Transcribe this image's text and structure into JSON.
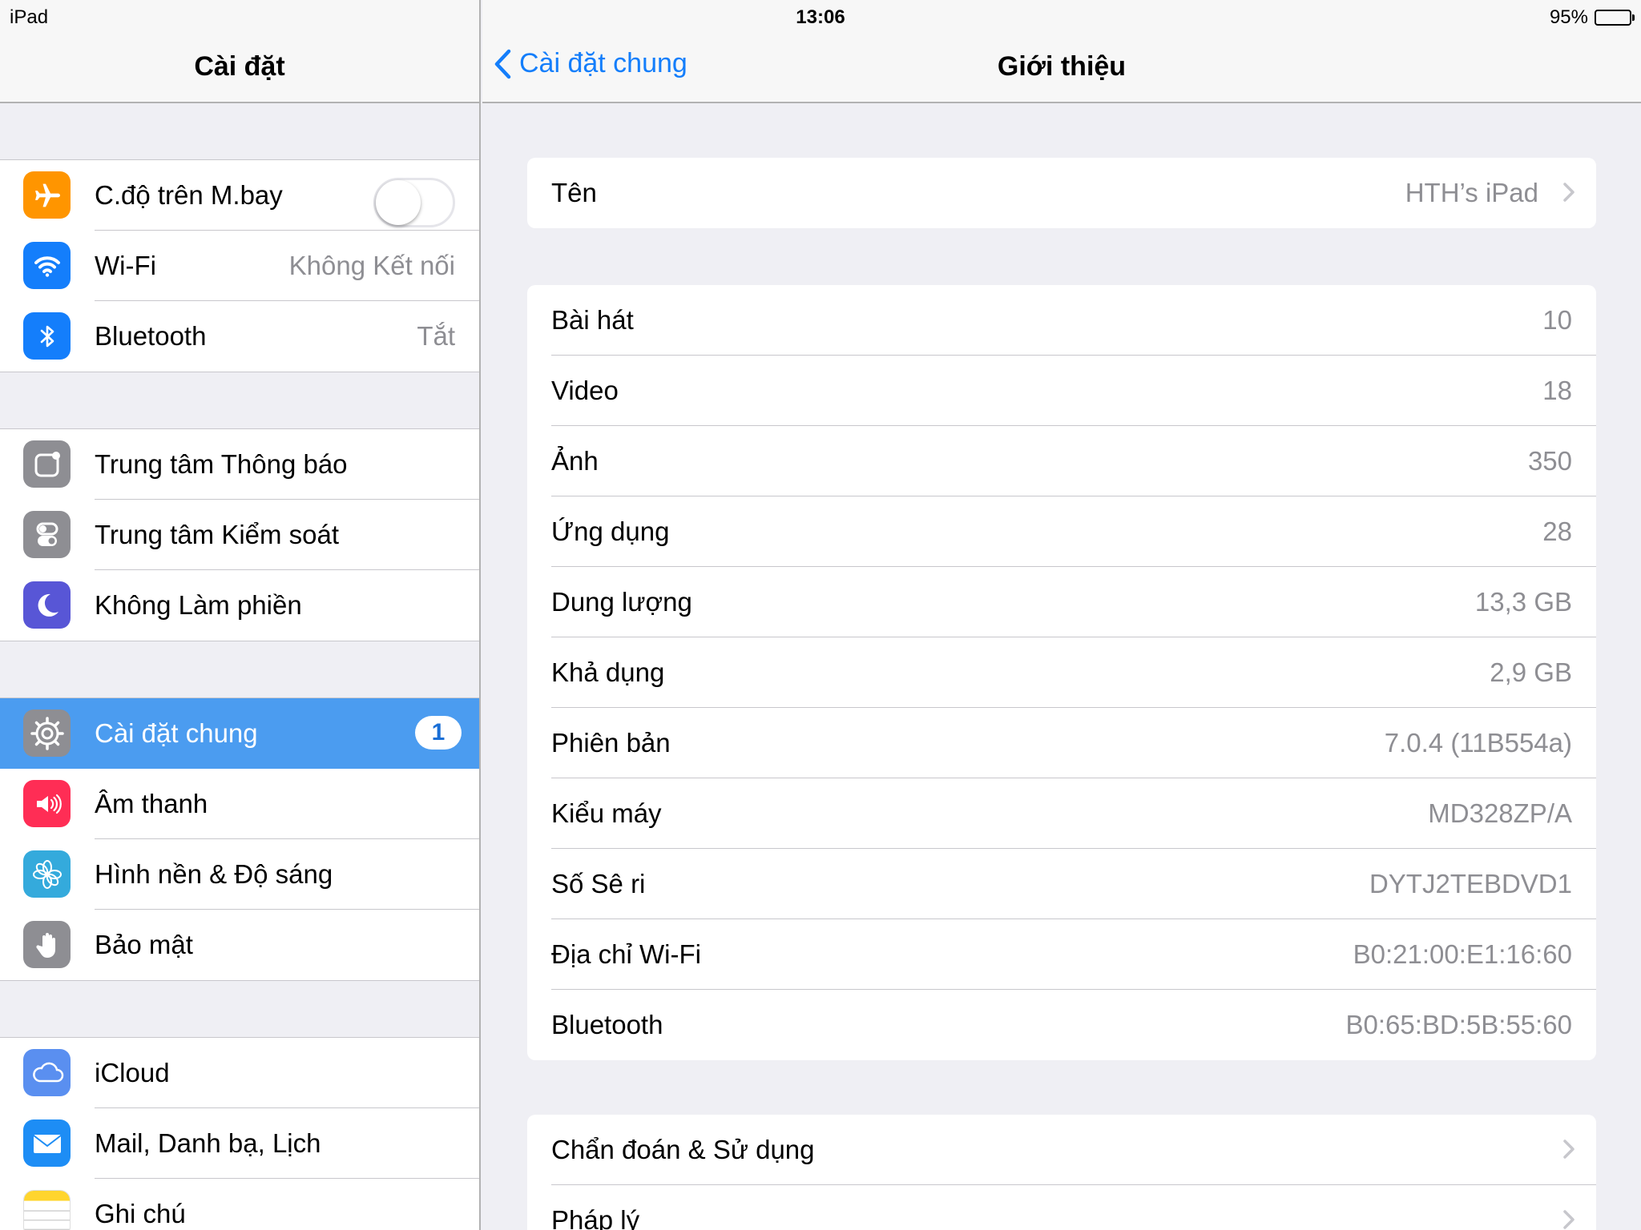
{
  "status_bar": {
    "device": "iPad",
    "time": "13:06",
    "battery": "95%",
    "battery_level": 0.95
  },
  "master": {
    "title": "Cài đặt",
    "groups": [
      [
        {
          "label": "C.độ trên M.bay",
          "icon": "airplane-icon",
          "color": "#ff9500",
          "toggle": false
        },
        {
          "label": "Wi-Fi",
          "detail": "Không Kết nối",
          "icon": "wifi-icon",
          "color": "#147efb"
        },
        {
          "label": "Bluetooth",
          "detail": "Tắt",
          "icon": "bluetooth-icon",
          "color": "#147efb"
        }
      ],
      [
        {
          "label": "Trung tâm Thông báo",
          "icon": "notification-center-icon",
          "color": "#8e8e93"
        },
        {
          "label": "Trung tâm Kiểm soát",
          "icon": "control-center-icon",
          "color": "#8e8e93"
        },
        {
          "label": "Không Làm phiền",
          "icon": "moon-icon",
          "color": "#5856d6"
        }
      ],
      [
        {
          "label": "Cài đặt chung",
          "badge": "1",
          "icon": "gear-icon",
          "color": "#8e8e93",
          "selected": true
        },
        {
          "label": "Âm thanh",
          "icon": "speaker-icon",
          "color": "#ff2d55"
        },
        {
          "label": "Hình nền & Độ sáng",
          "icon": "flower-icon",
          "color": "#34aadc"
        },
        {
          "label": "Bảo mật",
          "icon": "hand-icon",
          "color": "#8e8e93"
        }
      ],
      [
        {
          "label": "iCloud",
          "icon": "cloud-icon",
          "color": "#5a8ff0"
        },
        {
          "label": "Mail, Danh bạ, Lịch",
          "icon": "mail-icon",
          "color": "#1d8df5"
        },
        {
          "label": "Ghi chú",
          "icon": "notes-icon",
          "color": "#ffffff"
        }
      ]
    ]
  },
  "detail": {
    "back_label": "Cài đặt chung",
    "title": "Giới thiệu",
    "name_row": {
      "label": "Tên",
      "value": "HTH’s iPad"
    },
    "info_rows": [
      {
        "label": "Bài hát",
        "value": "10"
      },
      {
        "label": "Video",
        "value": "18"
      },
      {
        "label": "Ảnh",
        "value": "350"
      },
      {
        "label": "Ứng dụng",
        "value": "28"
      },
      {
        "label": "Dung lượng",
        "value": "13,3 GB"
      },
      {
        "label": "Khả dụng",
        "value": "2,9 GB"
      },
      {
        "label": "Phiên bản",
        "value": "7.0.4 (11B554a)"
      },
      {
        "label": "Kiểu máy",
        "value": "MD328ZP/A"
      },
      {
        "label": "Số Sê ri",
        "value": "DYTJ2TEBDVD1"
      },
      {
        "label": "Địa chỉ Wi-Fi",
        "value": "B0:21:00:E1:16:60"
      },
      {
        "label": "Bluetooth",
        "value": "B0:65:BD:5B:55:60"
      }
    ],
    "link_rows": [
      {
        "label": "Chẩn đoán & Sử dụng"
      },
      {
        "label": "Pháp lý"
      }
    ]
  }
}
